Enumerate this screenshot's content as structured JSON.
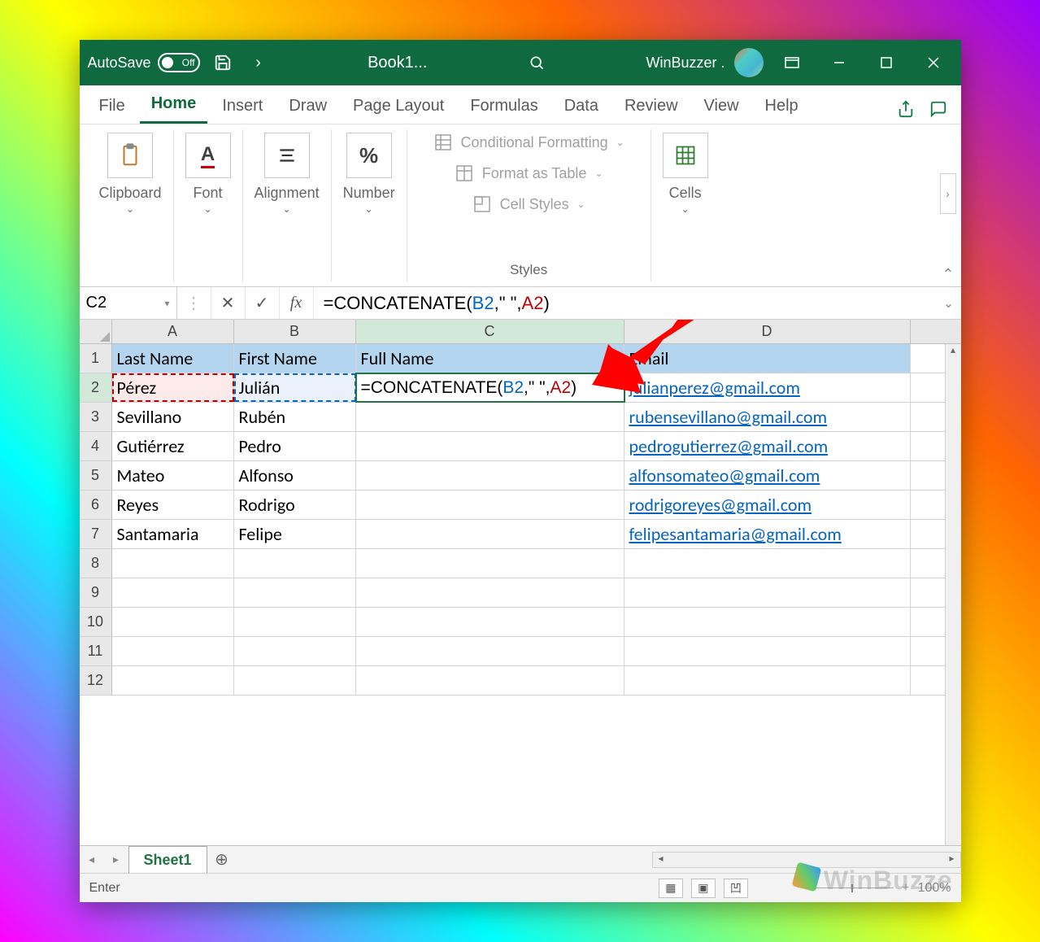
{
  "titlebar": {
    "autosave_label": "AutoSave",
    "autosave_state": "Off",
    "doc_name": "Book1...",
    "user_name": "WinBuzzer ."
  },
  "tabs": {
    "file": "File",
    "home": "Home",
    "insert": "Insert",
    "draw": "Draw",
    "page_layout": "Page Layout",
    "formulas": "Formulas",
    "data": "Data",
    "review": "Review",
    "view": "View",
    "help": "Help"
  },
  "ribbon": {
    "clipboard": "Clipboard",
    "font": "Font",
    "alignment": "Alignment",
    "number": "Number",
    "number_symbol": "%",
    "cond_format": "Conditional Formatting",
    "format_table": "Format as Table",
    "cell_styles": "Cell Styles",
    "styles_label": "Styles",
    "cells": "Cells"
  },
  "formula_bar": {
    "cell_ref": "C2",
    "formula_prefix": "=CONCATENATE(",
    "formula_b2": "B2",
    "formula_mid": ",\" \",",
    "formula_a2": "A2",
    "formula_suffix": ")"
  },
  "columns": {
    "A": "A",
    "B": "B",
    "C": "C",
    "D": "D"
  },
  "headers": {
    "last_name": "Last Name",
    "first_name": "First Name",
    "full_name": "Full Name",
    "email": "Email"
  },
  "rows": [
    {
      "n": "1"
    },
    {
      "n": "2",
      "last": "Pérez",
      "first": "Julián",
      "email": "julianperez@gmail.com"
    },
    {
      "n": "3",
      "last": "Sevillano",
      "first": "Rubén",
      "email": "rubensevillano@gmail.com"
    },
    {
      "n": "4",
      "last": "Gutiérrez",
      "first": "Pedro",
      "email": "pedrogutierrez@gmail.com"
    },
    {
      "n": "5",
      "last": "Mateo",
      "first": "Alfonso",
      "email": "alfonsomateo@gmail.com"
    },
    {
      "n": "6",
      "last": "Reyes",
      "first": "Rodrigo",
      "email": "rodrigoreyes@gmail.com"
    },
    {
      "n": "7",
      "last": "Santamaria",
      "first": "Felipe",
      "email": "felipesantamaria@gmail.com"
    },
    {
      "n": "8"
    },
    {
      "n": "9"
    },
    {
      "n": "10"
    },
    {
      "n": "11"
    },
    {
      "n": "12"
    }
  ],
  "editing_cell": {
    "prefix": "=CONCATENATE(",
    "b2": "B2",
    "mid": ",\" \",",
    "a2": "A2",
    "suffix": ")"
  },
  "sheet_tabs": {
    "sheet1": "Sheet1"
  },
  "statusbar": {
    "mode": "Enter",
    "zoom": "100%"
  },
  "watermark": "WinBuzze"
}
